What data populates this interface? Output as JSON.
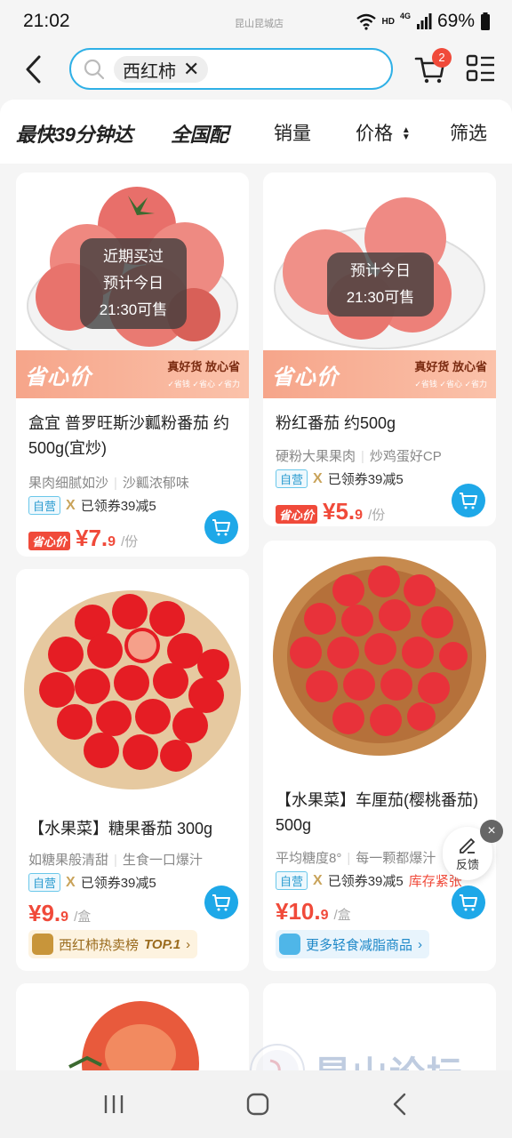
{
  "status_bar": {
    "time": "21:02",
    "carrier": "昆山昆城店",
    "hd": "HD",
    "network": "4G",
    "battery": "69%"
  },
  "search": {
    "query": "西红柿"
  },
  "cart": {
    "badge": "2"
  },
  "filters": [
    {
      "label": "最快39分钟达"
    },
    {
      "label": "全国配"
    },
    {
      "label": "销量"
    },
    {
      "label": "价格"
    },
    {
      "label": "筛选"
    }
  ],
  "products": [
    {
      "overlay": [
        "近期买过",
        "预计今日",
        "21:30可售"
      ],
      "promo": {
        "title": "省心价",
        "slogan": "真好货 放心省",
        "sub": "✓省钱 ✓省心 ✓省力"
      },
      "title": "盒宜 普罗旺斯沙瓤粉番茄 约500g(宜炒)",
      "subtitle": [
        "果肉细腻如沙",
        "沙瓤浓郁味"
      ],
      "tag_self": "自营",
      "coupon": "已领券39减5",
      "price_tag": "省心价",
      "price_main": "¥7.",
      "price_decimal": "9",
      "unit": "/份"
    },
    {
      "overlay": [
        "预计今日",
        "21:30可售"
      ],
      "promo": {
        "title": "省心价",
        "slogan": "真好货 放心省",
        "sub": "✓省钱 ✓省心 ✓省力"
      },
      "title": "粉红番茄 约500g",
      "subtitle": [
        "硬粉大果果肉",
        "炒鸡蛋好CP"
      ],
      "tag_self": "自营",
      "coupon": "已领券39减5",
      "price_tag": "省心价",
      "price_main": "¥5.",
      "price_decimal": "9",
      "unit": "/份"
    },
    {
      "title": "【水果菜】糖果番茄 300g",
      "subtitle": [
        "如糖果般清甜",
        "生食一口爆汁"
      ],
      "tag_self": "自营",
      "coupon": "已领券39减5",
      "price_main": "¥9.",
      "price_decimal": "9",
      "unit": "/盒",
      "rank": {
        "text": "西红柿热卖榜",
        "top": "TOP.1",
        "arrow": "›"
      }
    },
    {
      "title": "【水果菜】车厘茄(樱桃番茄) 500g",
      "subtitle": [
        "平均糖度8°",
        "每一颗都爆汁"
      ],
      "tag_self": "自营",
      "coupon": "已领券39减5",
      "stock": "库存紧张",
      "price_main": "¥10.",
      "price_decimal": "9",
      "unit": "/盒",
      "lite": {
        "text": "更多轻食减脂商品",
        "arrow": "›"
      }
    }
  ],
  "feedback": {
    "label": "反馈",
    "close": "×"
  },
  "watermark": {
    "text": "昆山论坛"
  }
}
